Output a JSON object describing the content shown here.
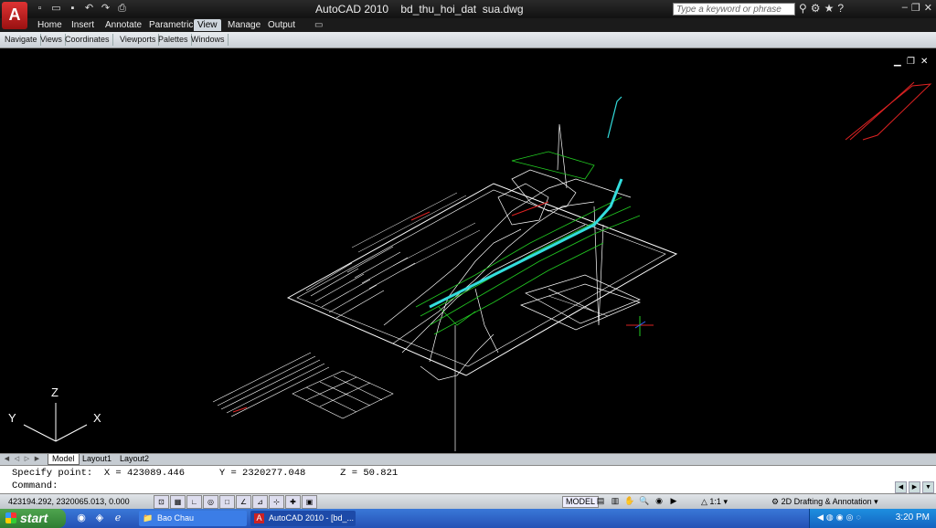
{
  "titlebar": {
    "title": "AutoCAD 2010    bd_thu_hoi_dat  sua.dwg",
    "search_placeholder": "Type a keyword or phrase",
    "logo": "A"
  },
  "ribbon_tabs": [
    "Home",
    "Insert",
    "Annotate",
    "Parametric",
    "View",
    "Manage",
    "Output"
  ],
  "active_tab": "View",
  "panels": [
    "Navigate",
    "Views",
    "Coordinates",
    "Viewports",
    "Palettes",
    "Windows"
  ],
  "canvas": {
    "axis_x": "X",
    "axis_y": "Y",
    "axis_z": "Z"
  },
  "layout_tabs": [
    "Model",
    "Layout1",
    "Layout2"
  ],
  "active_layout": "Model",
  "command": {
    "line1": "Specify point:  X = 423089.446      Y = 2320277.048      Z = 50.821",
    "line2": "Command:"
  },
  "status": {
    "coordinates": "423194.292, 2320065.013, 0.000",
    "model_label": "MODEL",
    "annotation_scale": "1:1",
    "workspace": "2D Drafting & Annotation"
  },
  "taskbar": {
    "start_label": "start",
    "task_folder": "Bao Chau",
    "task_autocad": "AutoCAD 2010 - [bd_...",
    "clock": "3:20 PM"
  },
  "colors": {
    "drawing_bg": "#000000",
    "linework": "#ffffff",
    "green_lines": "#22cc22",
    "cyan_road": "#33dddd",
    "red_lines": "#dd2222"
  }
}
